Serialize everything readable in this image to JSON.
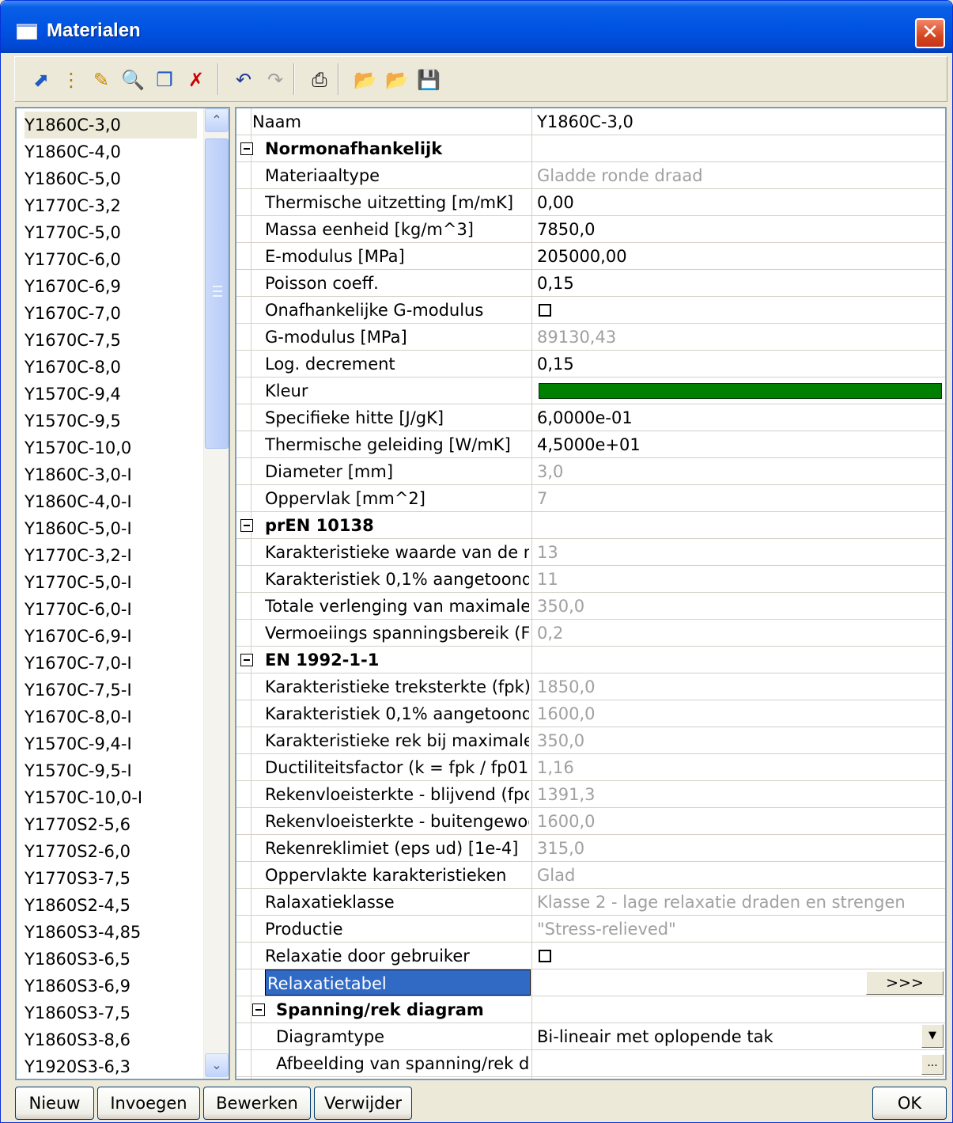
{
  "window": {
    "title": "Materialen",
    "close_label": "✕"
  },
  "toolbar": {
    "buttons": [
      {
        "name": "apply-icon",
        "glyph": "⬈",
        "color": "#1E5AC8"
      },
      {
        "name": "tree-icon",
        "glyph": "⋮",
        "color": "#B87A00"
      },
      {
        "name": "edit-pencil-icon",
        "glyph": "✎",
        "color": "#C88C00"
      },
      {
        "name": "find-icon",
        "glyph": "🔍",
        "color": "#333333"
      },
      {
        "name": "copy-icon",
        "glyph": "❐",
        "color": "#1E5AC8"
      },
      {
        "name": "delete-icon",
        "glyph": "✗",
        "color": "#CC0000"
      },
      {
        "name": "undo-icon",
        "glyph": "↶",
        "color": "#1E3C96"
      },
      {
        "name": "redo-icon",
        "glyph": "↷",
        "color": "#A0A0A0"
      },
      {
        "name": "print-icon",
        "glyph": "⎙",
        "color": "#000000"
      },
      {
        "name": "open-folder-icon",
        "glyph": "📂",
        "color": "#D4A000"
      },
      {
        "name": "open-folder-2-icon",
        "glyph": "📂",
        "color": "#D4A000"
      },
      {
        "name": "save-icon",
        "glyph": "💾",
        "color": "#000000"
      }
    ]
  },
  "materials": [
    "Y1860C-3,0",
    "Y1860C-4,0",
    "Y1860C-5,0",
    "Y1770C-3,2",
    "Y1770C-5,0",
    "Y1770C-6,0",
    "Y1670C-6,9",
    "Y1670C-7,0",
    "Y1670C-7,5",
    "Y1670C-8,0",
    "Y1570C-9,4",
    "Y1570C-9,5",
    "Y1570C-10,0",
    "Y1860C-3,0-I",
    "Y1860C-4,0-I",
    "Y1860C-5,0-I",
    "Y1770C-3,2-I",
    "Y1770C-5,0-I",
    "Y1770C-6,0-I",
    "Y1670C-6,9-I",
    "Y1670C-7,0-I",
    "Y1670C-7,5-I",
    "Y1670C-8,0-I",
    "Y1570C-9,4-I",
    "Y1570C-9,5-I",
    "Y1570C-10,0-I",
    "Y1770S2-5,6",
    "Y1770S2-6,0",
    "Y1770S3-7,5",
    "Y1860S2-4,5",
    "Y1860S3-4,85",
    "Y1860S3-6,5",
    "Y1860S3-6,9",
    "Y1860S3-7,5",
    "Y1860S3-8,6",
    "Y1920S3-6,3"
  ],
  "scrollbar": {
    "up_glyph": "⌃",
    "down_glyph": "⌄"
  },
  "properties": [
    {
      "type": "prop",
      "level": 0,
      "name": "Naam",
      "value": "Y1860C-3,0",
      "readonly": false
    },
    {
      "type": "cat",
      "level": 0,
      "name": "Normonafhankelijk"
    },
    {
      "type": "prop",
      "level": 1,
      "name": "Materiaaltype",
      "value": "Gladde ronde draad",
      "readonly": true
    },
    {
      "type": "prop",
      "level": 1,
      "name": "Thermische uitzetting [m/mK]",
      "value": "0,00",
      "readonly": false
    },
    {
      "type": "prop",
      "level": 1,
      "name": "Massa eenheid [kg/m^3]",
      "value": "7850,0",
      "readonly": false
    },
    {
      "type": "prop",
      "level": 1,
      "name": "E-modulus [MPa]",
      "value": "205000,00",
      "readonly": false
    },
    {
      "type": "prop",
      "level": 1,
      "name": "Poisson coeff.",
      "value": "0,15",
      "readonly": false
    },
    {
      "type": "check",
      "level": 1,
      "name": "Onafhankelijke G-modulus",
      "checked": false
    },
    {
      "type": "prop",
      "level": 1,
      "name": "G-modulus [MPa]",
      "value": "89130,43",
      "readonly": true
    },
    {
      "type": "prop",
      "level": 1,
      "name": "Log. decrement",
      "value": "0,15",
      "readonly": false
    },
    {
      "type": "color",
      "level": 1,
      "name": "Kleur",
      "color": "#008000"
    },
    {
      "type": "prop",
      "level": 1,
      "name": "Specifieke hitte [J/gK]",
      "value": "6,0000e-01",
      "readonly": false
    },
    {
      "type": "prop",
      "level": 1,
      "name": "Thermische geleiding [W/mK]",
      "value": "4,5000e+01",
      "readonly": false
    },
    {
      "type": "prop",
      "level": 1,
      "name": "Diameter [mm]",
      "value": "3,0",
      "readonly": true
    },
    {
      "type": "prop",
      "level": 1,
      "name": "Oppervlak [mm^2]",
      "value": "7",
      "readonly": true
    },
    {
      "type": "cat",
      "level": 0,
      "name": "prEN 10138"
    },
    {
      "type": "prop",
      "level": 1,
      "name": "Karakteristieke waarde van de m...",
      "value": "13",
      "readonly": true
    },
    {
      "type": "prop",
      "level": 1,
      "name": "Karakteristiek 0,1% aangetoonde...",
      "value": "11",
      "readonly": true
    },
    {
      "type": "prop",
      "level": 1,
      "name": "Totale verlenging van maximale ...",
      "value": "350,0",
      "readonly": true
    },
    {
      "type": "prop",
      "level": 1,
      "name": "Vermoeiings spanningsbereik (Fr)...",
      "value": "0,2",
      "readonly": true
    },
    {
      "type": "cat",
      "level": 0,
      "name": "EN 1992-1-1"
    },
    {
      "type": "prop",
      "level": 1,
      "name": "Karakteristieke treksterkte (fpk) [...",
      "value": "1850,0",
      "readonly": true
    },
    {
      "type": "prop",
      "level": 1,
      "name": "Karakteristiek 0,1% aangetoonde...",
      "value": "1600,0",
      "readonly": true
    },
    {
      "type": "prop",
      "level": 1,
      "name": "Karakteristieke rek bij maximale b...",
      "value": "350,0",
      "readonly": true
    },
    {
      "type": "prop",
      "level": 1,
      "name": "Ductiliteitsfactor (k = fpk / fp01k)...",
      "value": "1,16",
      "readonly": true
    },
    {
      "type": "prop",
      "level": 1,
      "name": "Rekenvloeisterkte - blijvend (fpd ...",
      "value": "1391,3",
      "readonly": true
    },
    {
      "type": "prop",
      "level": 1,
      "name": "Rekenvloeisterkte - buitengewoo...",
      "value": "1600,0",
      "readonly": true
    },
    {
      "type": "prop",
      "level": 1,
      "name": "Rekenreklimiet (eps ud) [1e-4]",
      "value": "315,0",
      "readonly": true
    },
    {
      "type": "prop",
      "level": 1,
      "name": "Oppervlakte karakteristieken",
      "value": "Glad",
      "readonly": true
    },
    {
      "type": "prop",
      "level": 1,
      "name": "Ralaxatieklasse",
      "value": "Klasse 2 - lage relaxatie draden en strengen",
      "readonly": true
    },
    {
      "type": "prop",
      "level": 1,
      "name": "Productie",
      "value": "\"Stress-relieved\"",
      "readonly": true
    },
    {
      "type": "check",
      "level": 1,
      "name": "Relaxatie door gebruiker",
      "checked": false
    },
    {
      "type": "button",
      "level": 1,
      "name": "Relaxatietabel",
      "button_label": ">>>",
      "selected": true
    },
    {
      "type": "cat",
      "level": 1,
      "name": "Spanning/rek diagram"
    },
    {
      "type": "dropdown",
      "level": 2,
      "name": "Diagramtype",
      "value": "Bi-lineair met oplopende tak"
    },
    {
      "type": "ellipsis",
      "level": 2,
      "name": "Afbeelding van spanning/rek di...",
      "button_label": "..."
    }
  ],
  "buttons": {
    "new": "Nieuw",
    "insert": "Invoegen",
    "edit": "Bewerken",
    "delete": "Verwijder",
    "ok": "OK"
  }
}
